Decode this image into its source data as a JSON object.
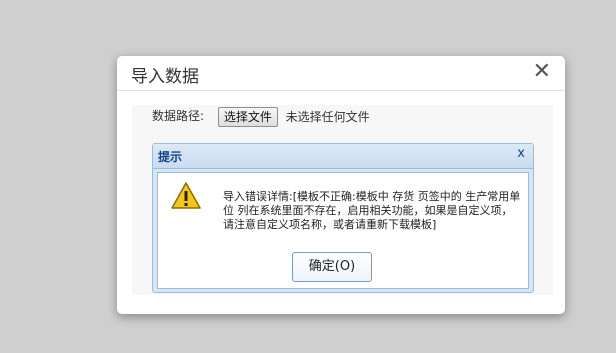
{
  "dialog": {
    "title": "导入数据",
    "close_glyph": "✕"
  },
  "file": {
    "label": "数据路径:",
    "button_label": "选择文件",
    "status": "未选择任何文件"
  },
  "alert": {
    "title": "提示",
    "close_glyph": "x",
    "icon": "warning-icon",
    "message": "导入错误详情:[模板不正确:模板中 存货 页签中的 生产常用单位 列在系统里面不存在，启用相关功能，如果是自定义项，请注意自定义项名称，或者请重新下载模板]",
    "ok_label": "确定(O)"
  }
}
